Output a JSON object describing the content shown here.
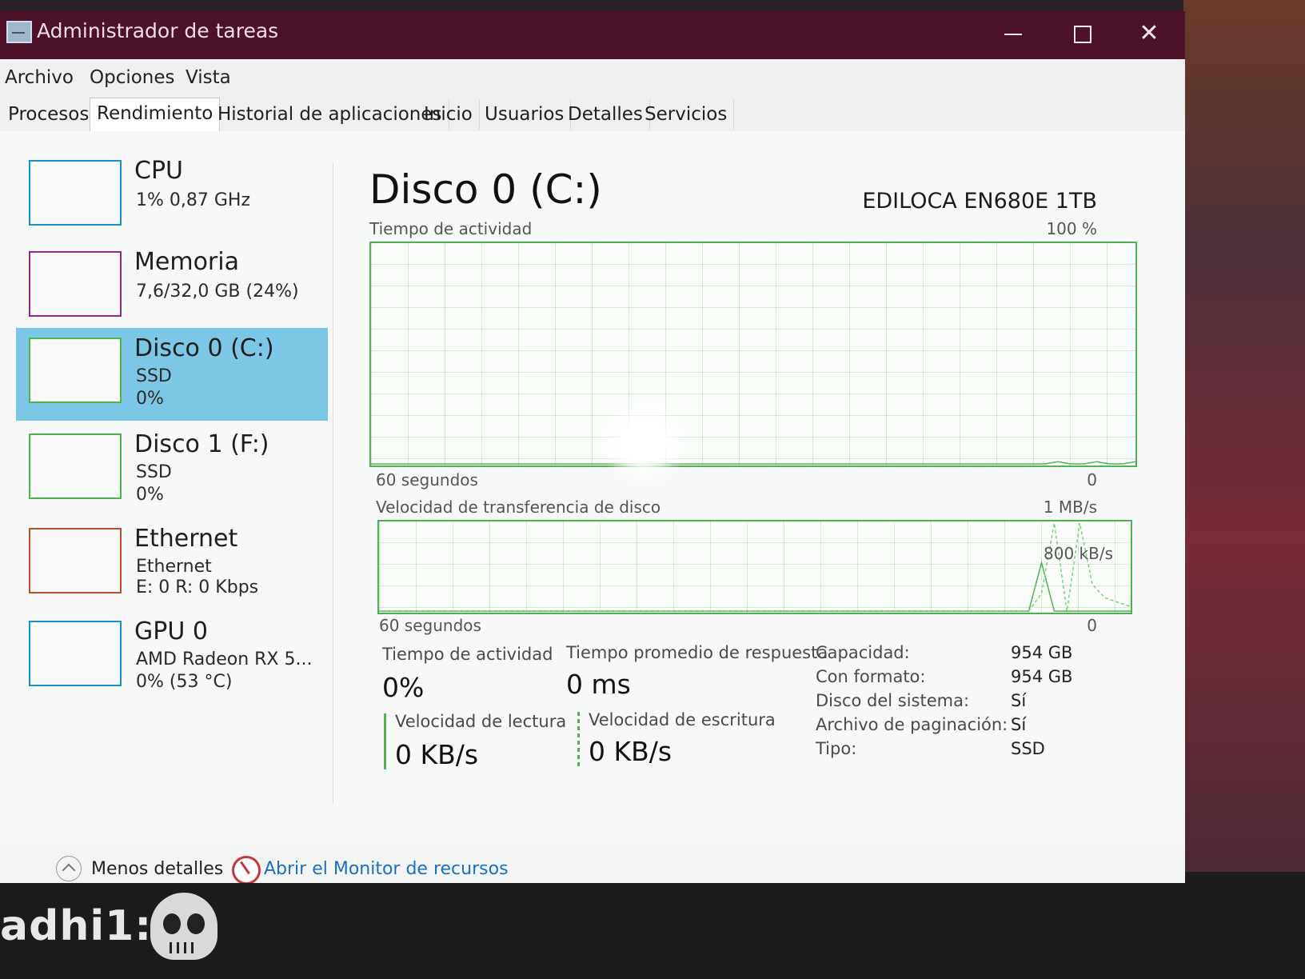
{
  "window": {
    "title": "Administrador de tareas"
  },
  "menu": [
    "Archivo",
    "Opciones",
    "Vista"
  ],
  "tabs": [
    {
      "label": "Procesos",
      "active": false
    },
    {
      "label": "Rendimiento",
      "active": true
    },
    {
      "label": "Historial de aplicaciones",
      "active": false
    },
    {
      "label": "Inicio",
      "active": false
    },
    {
      "label": "Usuarios",
      "active": false
    },
    {
      "label": "Detalles",
      "active": false
    },
    {
      "label": "Servicios",
      "active": false
    }
  ],
  "sidebar": {
    "items": [
      {
        "name": "CPU",
        "line1": "1% 0,87 GHz",
        "line2": "",
        "color": "#1a8ecd",
        "selected": false
      },
      {
        "name": "Memoria",
        "line1": "7,6/32,0 GB (24%)",
        "line2": "",
        "color": "#8b2a8b",
        "selected": false
      },
      {
        "name": "Disco 0 (C:)",
        "line1": "SSD",
        "line2": "0%",
        "color": "#4fb34f",
        "selected": true
      },
      {
        "name": "Disco 1 (F:)",
        "line1": "SSD",
        "line2": "0%",
        "color": "#4fb34f",
        "selected": false
      },
      {
        "name": "Ethernet",
        "line1": "Ethernet",
        "line2": "E: 0 R: 0 Kbps",
        "color": "#b5502a",
        "selected": false
      },
      {
        "name": "GPU 0",
        "line1": "AMD Radeon RX 5...",
        "line2": "0% (53 °C)",
        "color": "#1a8ecd",
        "selected": false
      }
    ]
  },
  "main": {
    "title": "Disco 0 (C:)",
    "model": "EDILOCA EN680E 1TB",
    "activity_graph": {
      "label": "Tiempo de actividad",
      "max_label": "100 %",
      "time_label": "60 segundos",
      "min_label": "0",
      "values": [
        0,
        0,
        0,
        0,
        0,
        0,
        0,
        0,
        0,
        0,
        0,
        0,
        0,
        0,
        0,
        0,
        0,
        0,
        0,
        0,
        0,
        0,
        0,
        0,
        0,
        0,
        0,
        0,
        0,
        0,
        0,
        0,
        0,
        0,
        0,
        0,
        0,
        0,
        0,
        0,
        0,
        0,
        0,
        0,
        0,
        0,
        0,
        0,
        0,
        0,
        0,
        0,
        0,
        1,
        0,
        0,
        1,
        0,
        0,
        1
      ]
    },
    "transfer_graph": {
      "label": "Velocidad de transferencia de disco",
      "max_label": "1 MB/s",
      "mid_label": "800 kB/s",
      "time_label": "60 segundos",
      "min_label": "0",
      "read_values": [
        0,
        0,
        0,
        0,
        0,
        0,
        0,
        0,
        0,
        0,
        0,
        0,
        0,
        0,
        0,
        0,
        0,
        0,
        0,
        0,
        0,
        0,
        0,
        0,
        0,
        0,
        0,
        0,
        0,
        0,
        0,
        0,
        0,
        0,
        0,
        0,
        0,
        0,
        0,
        0,
        0,
        0,
        0,
        0,
        0,
        0,
        0,
        0,
        0,
        0,
        0,
        0,
        550,
        0,
        0,
        0,
        0,
        0,
        0,
        0
      ],
      "write_values": [
        0,
        0,
        0,
        0,
        0,
        0,
        0,
        0,
        0,
        0,
        0,
        0,
        0,
        0,
        0,
        0,
        0,
        0,
        0,
        0,
        0,
        0,
        0,
        0,
        0,
        0,
        0,
        0,
        0,
        0,
        0,
        0,
        0,
        0,
        0,
        0,
        0,
        0,
        0,
        0,
        0,
        0,
        0,
        0,
        0,
        0,
        0,
        0,
        0,
        0,
        0,
        0,
        200,
        1000,
        0,
        1000,
        300,
        150,
        100,
        50
      ]
    },
    "stats": {
      "activity_label": "Tiempo de actividad",
      "activity_value": "0%",
      "response_label": "Tiempo promedio de respuesta",
      "response_value": "0 ms",
      "read_label": "Velocidad de lectura",
      "read_value": "0 KB/s",
      "write_label": "Velocidad de escritura",
      "write_value": "0 KB/s"
    },
    "properties": [
      {
        "label": "Capacidad:",
        "value": "954 GB"
      },
      {
        "label": "Con formato:",
        "value": "954 GB"
      },
      {
        "label": "Disco del sistema:",
        "value": "Sí"
      },
      {
        "label": "Archivo de paginación:",
        "value": "Sí"
      },
      {
        "label": "Tipo:",
        "value": "SSD"
      }
    ]
  },
  "footer": {
    "less_details": "Menos detalles",
    "resource_monitor": "Abrir el Monitor de recursos"
  },
  "overlay": {
    "chat_text": "adhi1:"
  },
  "colors": {
    "titlebar": "#4d1229",
    "selected": "#7cc7e6",
    "disk_green": "#4fb34f",
    "link": "#1a6fc2"
  }
}
